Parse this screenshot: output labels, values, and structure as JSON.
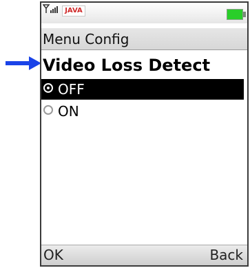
{
  "status_bar": {
    "java_badge": "JAVA",
    "battery_color": "#29ce29"
  },
  "menu": {
    "title": "Menu Config"
  },
  "screen": {
    "heading": "Video Loss Detect",
    "options": [
      {
        "label": "OFF",
        "selected": true
      },
      {
        "label": "ON",
        "selected": false
      }
    ]
  },
  "softkeys": {
    "left_label": "OK",
    "right_label": "Back"
  },
  "colors": {
    "pointer_arrow": "#1a43e8",
    "selection_background": "#000000"
  }
}
